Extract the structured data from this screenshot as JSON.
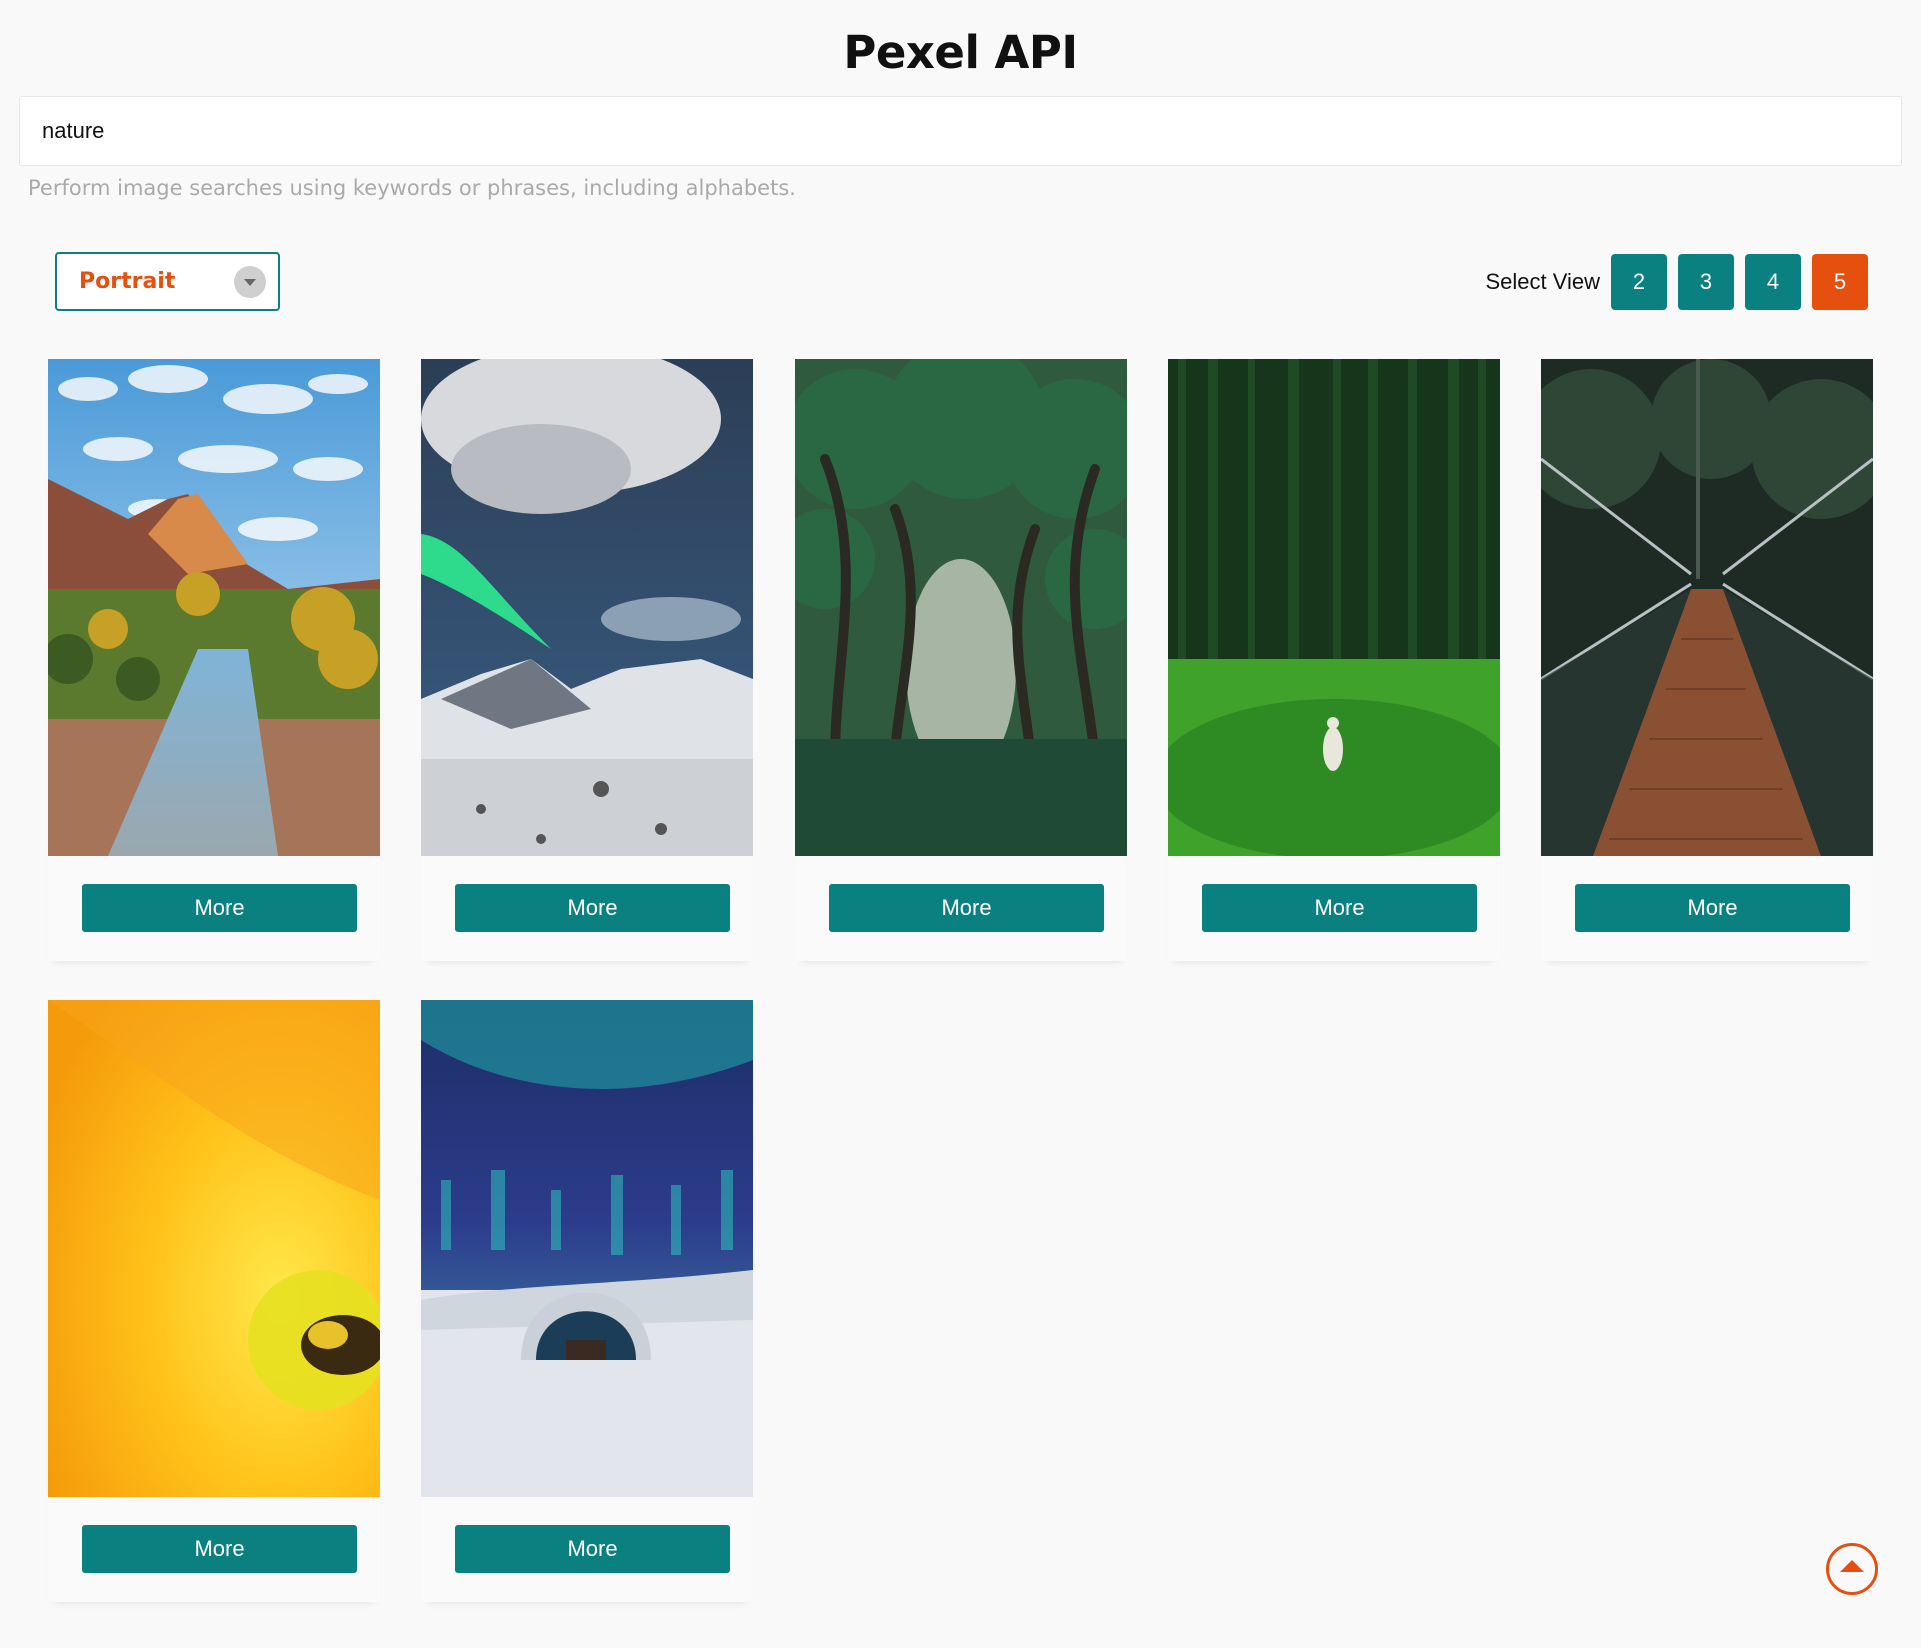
{
  "header": {
    "title": "Pexel API"
  },
  "search": {
    "value": "nature",
    "hint": "Perform image searches using keywords or phrases, including alphabets."
  },
  "filter": {
    "orientation": "Portrait"
  },
  "view": {
    "label": "Select View",
    "options": [
      "2",
      "3",
      "4",
      "5"
    ],
    "active": "5"
  },
  "results": [
    {
      "subject": "canyon river with mountain peak",
      "button_label": "More"
    },
    {
      "subject": "aurora over snowy mountain",
      "button_label": "More"
    },
    {
      "subject": "tree tunnel avenue",
      "button_label": "More"
    },
    {
      "subject": "person in green forest",
      "button_label": "More"
    },
    {
      "subject": "suspension bridge in forest",
      "button_label": "More"
    },
    {
      "subject": "bee on yellow flower",
      "button_label": "More"
    },
    {
      "subject": "aurora over ice hotel",
      "button_label": "More"
    }
  ]
}
